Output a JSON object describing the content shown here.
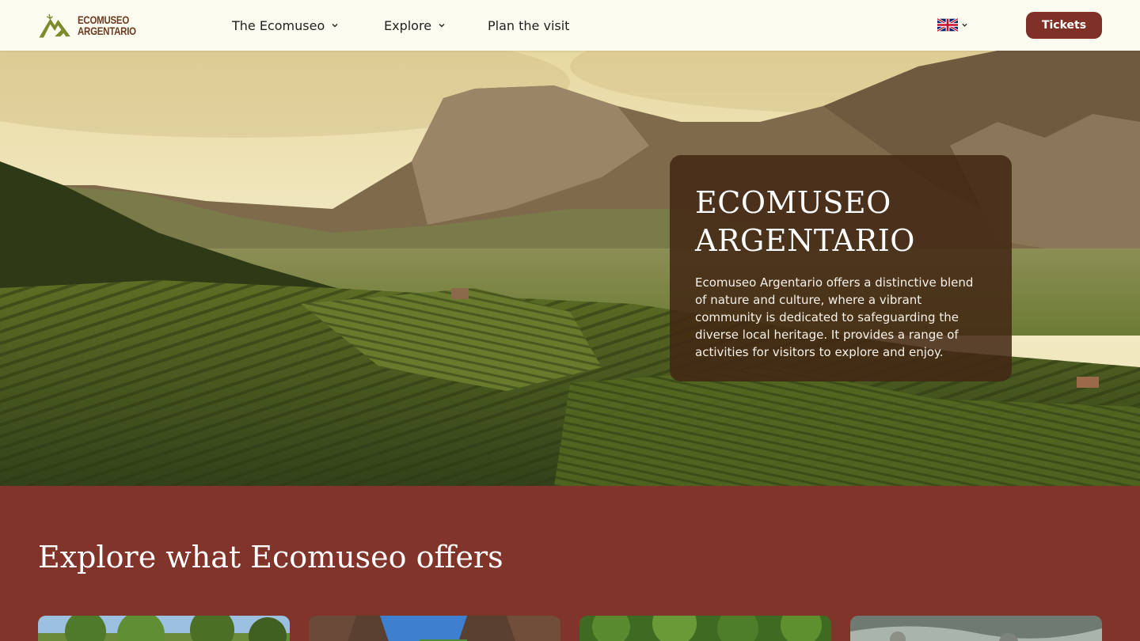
{
  "logo": {
    "line1": "ECOMUSEO",
    "line2": "ARGENTARIO",
    "icon": "mountain-logo-icon",
    "colors": {
      "mountain": "#7d8c2a",
      "text": "#6b3a1f"
    }
  },
  "nav": {
    "items": [
      {
        "label": "The Ecomuseo",
        "has_dropdown": true
      },
      {
        "label": "Explore",
        "has_dropdown": true
      },
      {
        "label": "Plan the visit",
        "has_dropdown": false
      }
    ],
    "language_icon": "uk-flag-icon",
    "tickets_label": "Tickets"
  },
  "hero": {
    "title_line1": "ECOMUSEO",
    "title_line2": "ARGENTARIO",
    "description": "Ecomuseo Argentario offers a distinctive blend of nature and culture, where a vibrant community is dedicated to safeguarding the diverse local heritage. It provides a range of activities for visitors to explore and enjoy."
  },
  "explore": {
    "title": "Explore what Ecomuseo offers"
  },
  "colors": {
    "header_bg": "#fdfcf0",
    "accent": "#7f3127",
    "section_bg": "#813429",
    "card_overlay": "#42261488"
  }
}
